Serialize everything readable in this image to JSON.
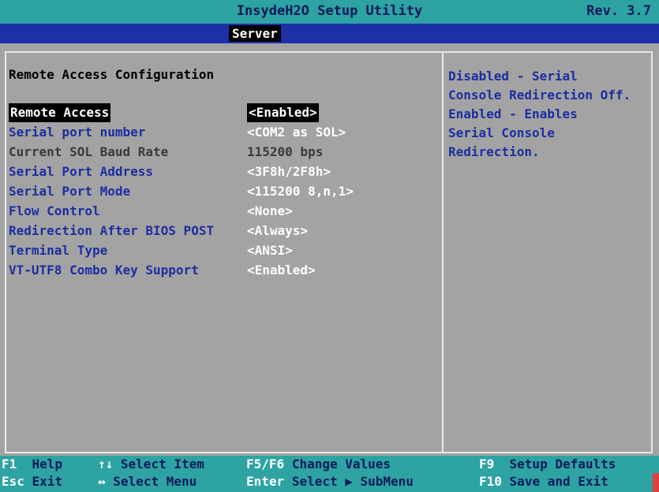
{
  "header": {
    "title": "InsydeH2O Setup Utility",
    "revision": "Rev. 3.7"
  },
  "menu": {
    "active_tab": "Server"
  },
  "page": {
    "section_title": "Remote Access Configuration"
  },
  "settings": [
    {
      "label": "Remote Access",
      "value": "<Enabled>"
    },
    {
      "label": "Serial port number",
      "value": "<COM2 as SOL>"
    },
    {
      "label": "Current SOL Baud Rate",
      "value": "115200 bps"
    },
    {
      "label": "Serial Port Address",
      "value": "<3F8h/2F8h>"
    },
    {
      "label": "Serial Port Mode",
      "value": "<115200 8,n,1>"
    },
    {
      "label": "Flow Control",
      "value": "<None>"
    },
    {
      "label": "Redirection After BIOS POST",
      "value": "<Always>"
    },
    {
      "label": "Terminal Type",
      "value": "<ANSI>"
    },
    {
      "label": "VT-UTF8 Combo Key Support",
      "value": "<Enabled>"
    }
  ],
  "help": {
    "lines": [
      "Disabled - Serial",
      "Console Redirection Off.",
      "Enabled - Enables",
      "Serial Console",
      "Redirection."
    ]
  },
  "footer": {
    "keys": [
      {
        "key": "F1",
        "desc": "Help"
      },
      {
        "key": "↑↓",
        "desc": "Select Item"
      },
      {
        "key": "F5/F6",
        "desc": "Change Values"
      },
      {
        "key": "F9",
        "desc": "Setup Defaults"
      },
      {
        "key": "Esc",
        "desc": "Exit"
      },
      {
        "key": "↔",
        "desc": "Select Menu"
      },
      {
        "key": "Enter",
        "desc": "Select ▶ SubMenu"
      },
      {
        "key": "F10",
        "desc": "Save and Exit"
      }
    ]
  },
  "colors": {
    "title_bar": "#2ea3a3",
    "menu_bar": "#1e30a8",
    "panel_bg": "#a3a3a3",
    "label_blue": "#1c2ea0",
    "selected_bg": "#000000"
  }
}
